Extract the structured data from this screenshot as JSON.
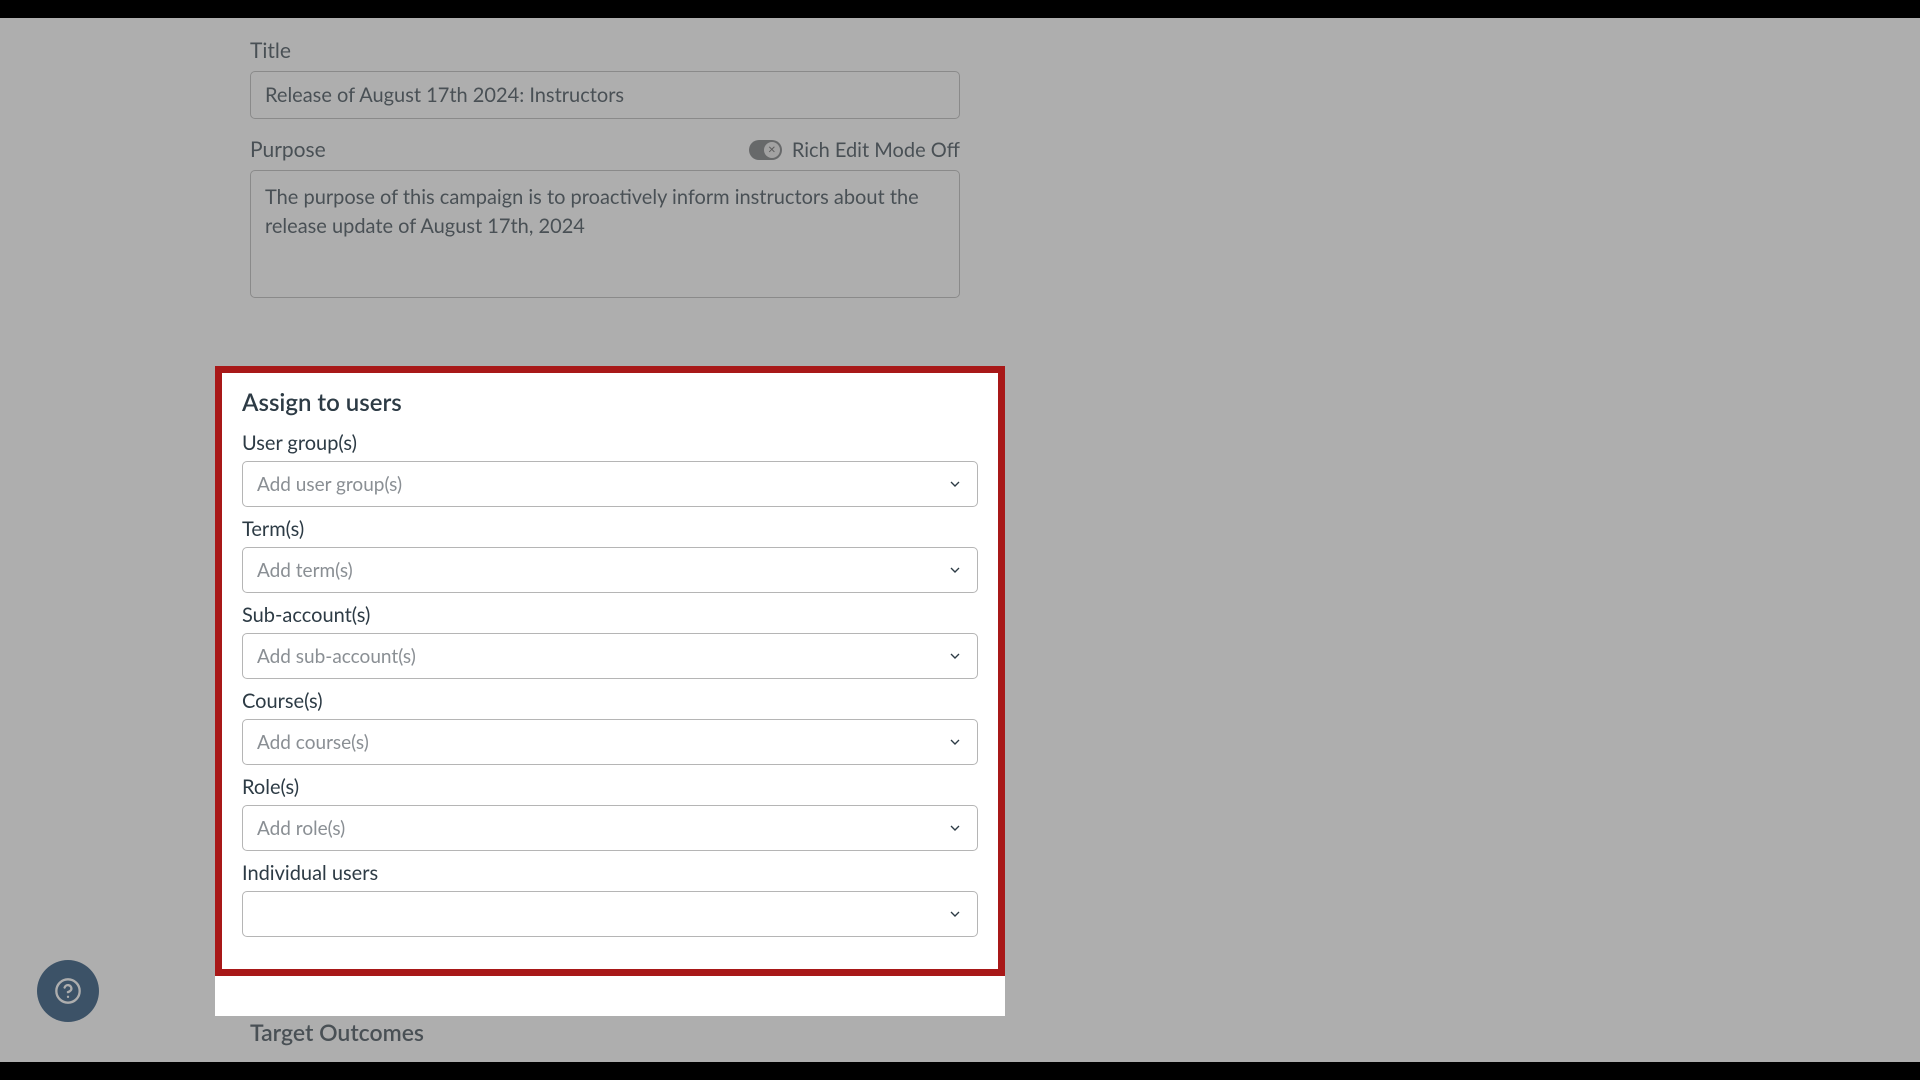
{
  "form": {
    "title_label": "Title",
    "title_value": "Release of August 17th 2024: Instructors",
    "purpose_label": "Purpose",
    "rich_edit_label": "Rich Edit Mode Off",
    "purpose_value": "The purpose of this campaign is to proactively inform instructors about the release update of August 17th, 2024"
  },
  "assign": {
    "heading": "Assign to users",
    "fields": [
      {
        "label": "User group(s)",
        "placeholder": "Add user group(s)"
      },
      {
        "label": "Term(s)",
        "placeholder": "Add term(s)"
      },
      {
        "label": "Sub-account(s)",
        "placeholder": "Add sub-account(s)"
      },
      {
        "label": "Course(s)",
        "placeholder": "Add course(s)"
      },
      {
        "label": "Role(s)",
        "placeholder": "Add role(s)"
      },
      {
        "label": "Individual users",
        "placeholder": ""
      }
    ]
  },
  "target_outcomes_heading": "Target Outcomes"
}
